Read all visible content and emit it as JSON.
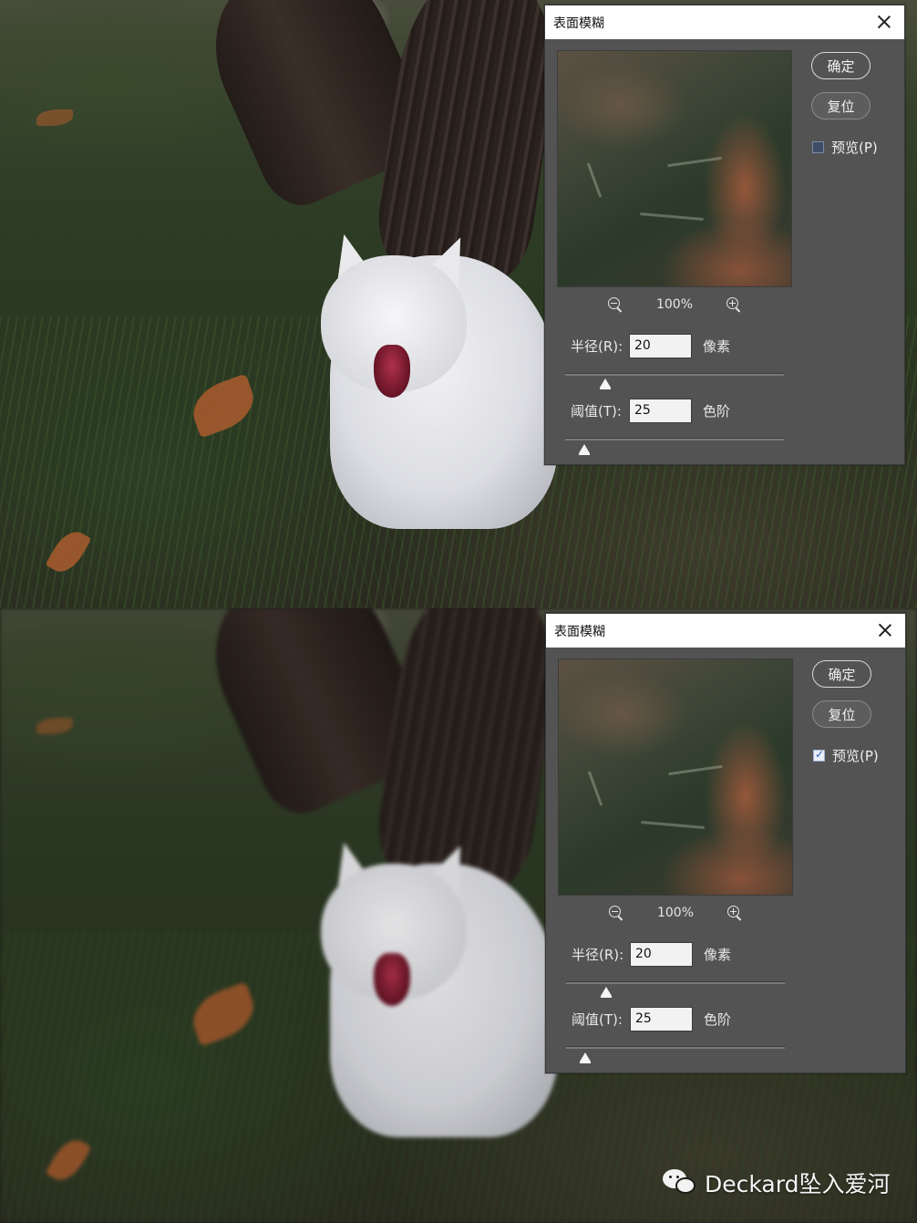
{
  "panels": [
    {
      "dialog": {
        "title": "表面模糊",
        "ok_label": "确定",
        "reset_label": "复位",
        "preview_label": "预览(P)",
        "preview_checked": false,
        "zoom_level": "100%",
        "radius": {
          "label": "半径(R):",
          "value": "20",
          "unit": "像素"
        },
        "threshold": {
          "label": "阈值(T):",
          "value": "25",
          "unit": "色阶"
        }
      }
    },
    {
      "dialog": {
        "title": "表面模糊",
        "ok_label": "确定",
        "reset_label": "复位",
        "preview_label": "预览(P)",
        "preview_checked": true,
        "zoom_level": "100%",
        "radius": {
          "label": "半径(R):",
          "value": "20",
          "unit": "像素"
        },
        "threshold": {
          "label": "阈值(T):",
          "value": "25",
          "unit": "色阶"
        }
      }
    }
  ],
  "watermark": {
    "text": "Deckard坠入爱河",
    "icon": "wechat-icon"
  },
  "colors": {
    "dialog_bg": "#535353",
    "titlebar_bg": "#fefefe",
    "checkbox_accent": "#2c5ec9"
  }
}
